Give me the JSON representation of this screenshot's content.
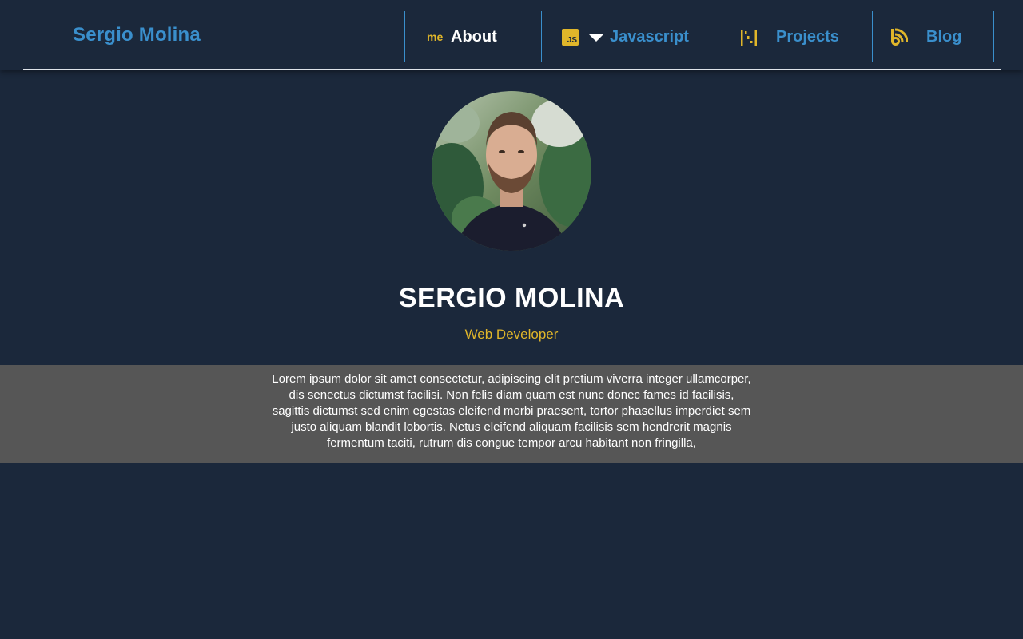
{
  "header": {
    "brand": "Sergio Molina",
    "nav": [
      {
        "icon": "me",
        "label": "About",
        "active": true
      },
      {
        "icon": "js-logo-icon",
        "icon_text": "JS",
        "label": "Javascript",
        "has_dropdown": true
      },
      {
        "icon": "projects-icon",
        "label": "Projects"
      },
      {
        "icon": "rss-icon",
        "label": "Blog"
      }
    ]
  },
  "profile": {
    "name": "SERGIO MOLINA",
    "role": "Web Developer",
    "avatar": "profile-photo"
  },
  "bio": {
    "text": "Lorem ipsum dolor sit amet consectetur, adipiscing elit pretium viverra integer ullamcorper, dis senectus dictumst facilisi. Non felis diam quam est nunc donec fames id facilisis, sagittis dictumst sed enim egestas eleifend morbi praesent, tortor phasellus imperdiet sem justo aliquam blandit lobortis. Netus eleifend aliquam facilisis sem hendrerit magnis fermentum taciti, rutrum dis congue tempor arcu habitant non fringilla,"
  },
  "colors": {
    "background": "#1b283b",
    "link": "#3a8fcc",
    "accent": "#e0b62a",
    "band": "#565656"
  }
}
